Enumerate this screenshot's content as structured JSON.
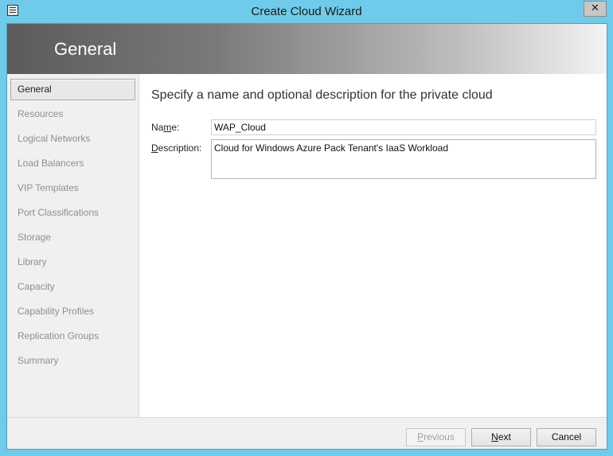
{
  "window": {
    "title": "Create Cloud Wizard",
    "close_glyph": "✕",
    "icon": "app-window-icon",
    "accent": "#6fcbe9"
  },
  "banner": {
    "title": "General"
  },
  "nav": {
    "items": [
      {
        "label": "General",
        "selected": true
      },
      {
        "label": "Resources"
      },
      {
        "label": "Logical Networks"
      },
      {
        "label": "Load Balancers"
      },
      {
        "label": "VIP Templates"
      },
      {
        "label": "Port Classifications"
      },
      {
        "label": "Storage"
      },
      {
        "label": "Library"
      },
      {
        "label": "Capacity"
      },
      {
        "label": "Capability Profiles"
      },
      {
        "label": "Replication Groups"
      },
      {
        "label": "Summary"
      }
    ]
  },
  "main": {
    "heading": "Specify a name and optional description for the private cloud",
    "name_label_prefix": "Na",
    "name_label_accel": "m",
    "name_label_suffix": "e:",
    "name_value": "WAP_Cloud",
    "description_label_accel": "D",
    "description_label_suffix": "escription:",
    "description_value": "Cloud for Windows Azure Pack Tenant's IaaS Workload"
  },
  "footer": {
    "previous_accel": "P",
    "previous_rest": "revious",
    "next_accel": "N",
    "next_rest": "ext",
    "cancel_label": "Cancel"
  }
}
